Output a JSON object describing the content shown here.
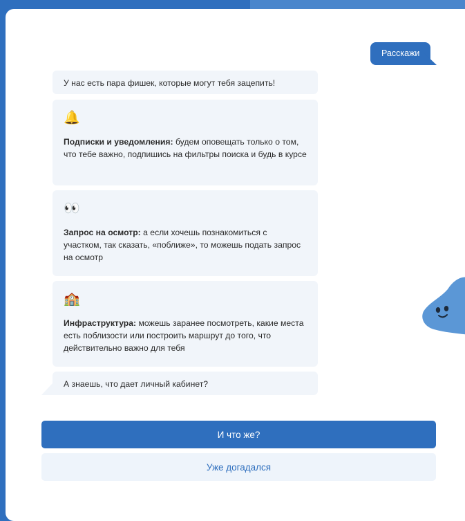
{
  "chat": {
    "user_reply": "Расскажи",
    "intro": "У нас есть пара фишек, которые могут тебя зацепить!",
    "features": [
      {
        "emoji": "🔔",
        "title": "Подписки и уведомления:",
        "text": " будем оповещать только о том, что тебе важно, подпишись на фильтры поиска и будь в курсе"
      },
      {
        "emoji": "👀",
        "title": "Запрос на осмотр:",
        "text": " а если хочешь познакомиться с участком, так сказать, «поближе», то можешь подать запрос на осмотр"
      },
      {
        "emoji": "🏫",
        "title": "Инфраструктура:",
        "text": " можешь заранее посмотреть, какие места есть поблизости или построить маршрут до того, что действительно важно для тебя"
      },
      null
    ],
    "question": "А знаешь, что дает личный кабинет?"
  },
  "actions": {
    "primary_label": "И что же?",
    "secondary_label": "Уже догадался"
  },
  "colors": {
    "accent": "#2f6fbe",
    "bubble_bg": "#f1f5fa",
    "secondary_button_bg": "#eef4fb"
  }
}
